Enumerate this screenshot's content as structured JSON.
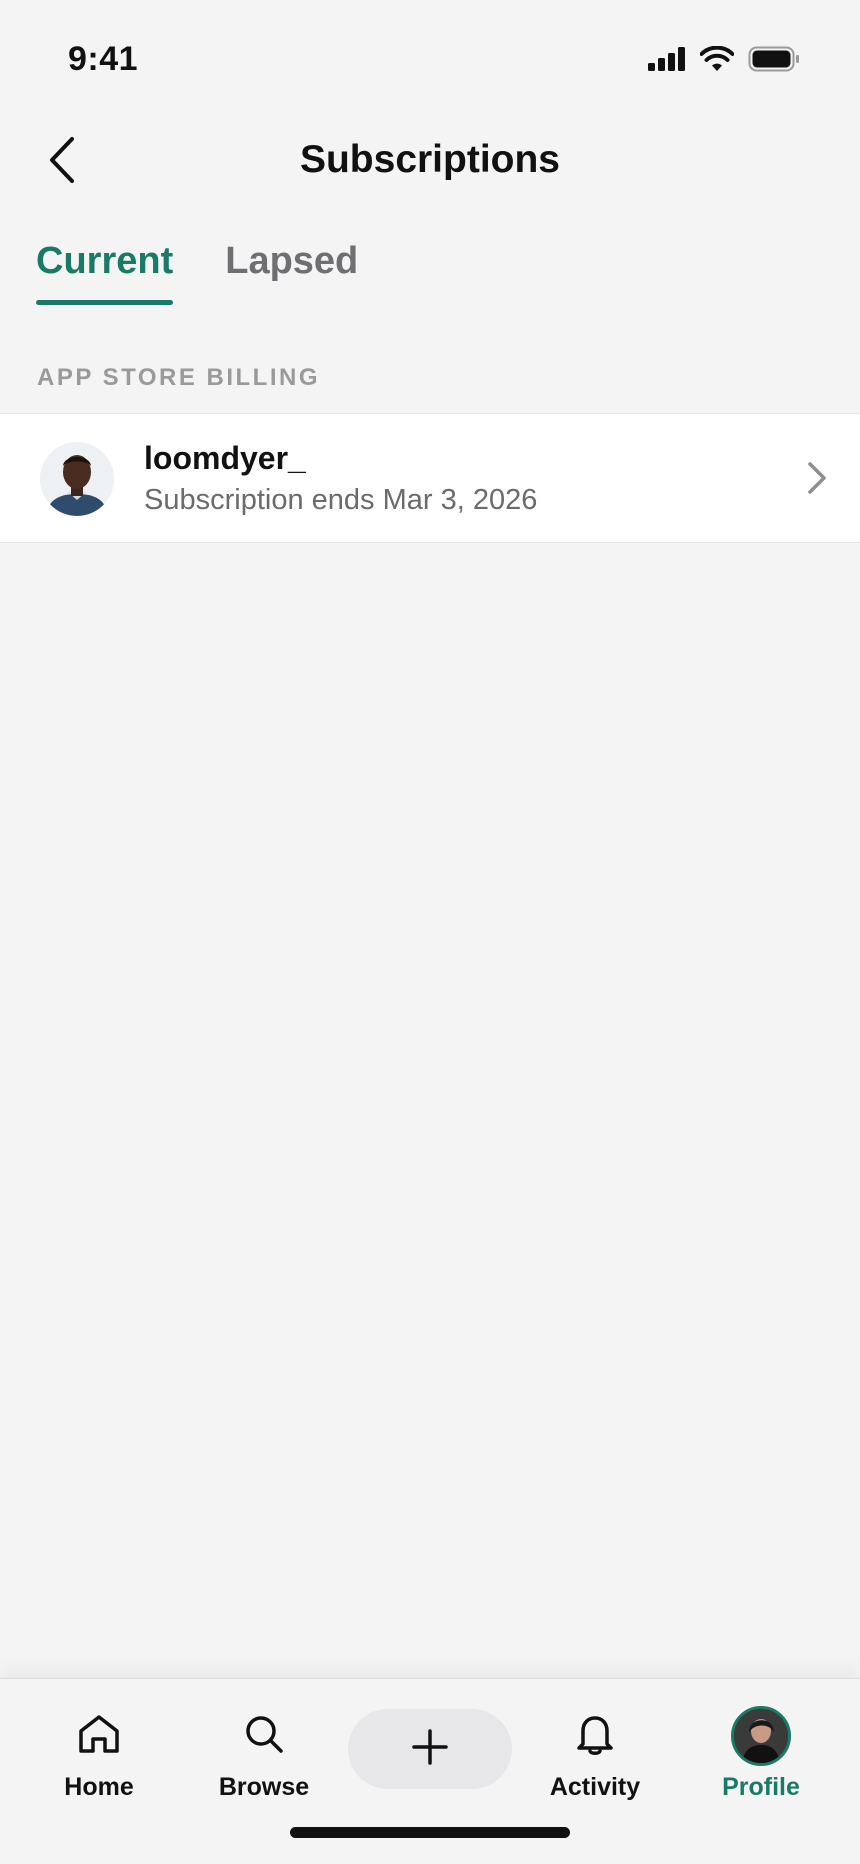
{
  "status_bar": {
    "time": "9:41",
    "icons": [
      "cellular-signal-icon",
      "wifi-icon",
      "battery-icon"
    ]
  },
  "header": {
    "title": "Subscriptions",
    "back_icon": "chevron-left-icon"
  },
  "tabs": [
    {
      "label": "Current",
      "active": true
    },
    {
      "label": "Lapsed",
      "active": false
    }
  ],
  "section": {
    "label": "APP STORE BILLING"
  },
  "subscriptions": [
    {
      "username": "loomdyer_",
      "detail": "Subscription ends Mar 3, 2026",
      "icon": "chevron-right-icon"
    }
  ],
  "bottom_nav": {
    "items": [
      {
        "label": "Home",
        "icon": "home-icon"
      },
      {
        "label": "Browse",
        "icon": "search-icon"
      },
      {
        "label": "",
        "icon": "plus-icon"
      },
      {
        "label": "Activity",
        "icon": "bell-icon"
      },
      {
        "label": "Profile",
        "icon": "avatar",
        "active": true
      }
    ]
  },
  "colors": {
    "accent": "#197a67",
    "background": "#f4f4f4",
    "text_secondary": "#6b6b6b"
  }
}
